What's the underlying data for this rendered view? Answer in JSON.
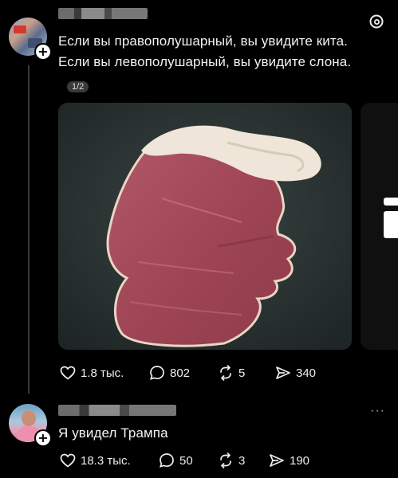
{
  "post": {
    "text_line1": "Если вы правополушарный, вы увидите кита.",
    "text_line2": "Если вы левополушарный, вы увидите слона.",
    "image_counter": "1/2",
    "likes": "1.8 тыс.",
    "replies": "802",
    "reposts": "5",
    "shares": "340"
  },
  "reply": {
    "text": "Я увидел Трампа",
    "likes": "18.3 тыс.",
    "replies": "50",
    "reposts": "3",
    "shares": "190"
  },
  "colors": {
    "background": "#000000",
    "text": "#f3f3f3",
    "meat": "#a84a5a",
    "fat": "#efe5d8"
  }
}
